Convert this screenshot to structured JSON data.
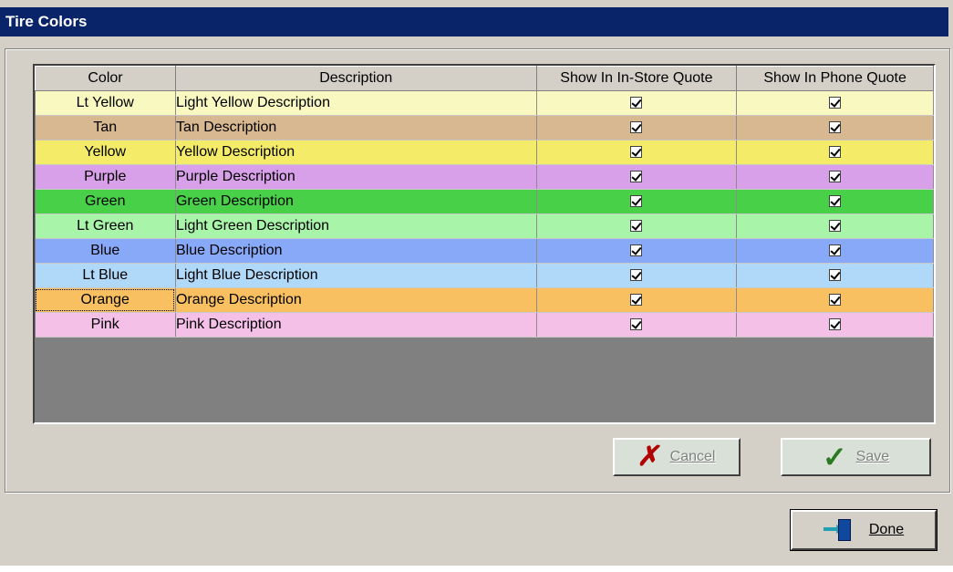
{
  "window": {
    "title": "Tire Colors"
  },
  "grid": {
    "columns": [
      "Color",
      "Description",
      "Show In In-Store Quote",
      "Show In Phone Quote"
    ],
    "rows": [
      {
        "color": "Lt Yellow",
        "description": "Light Yellow Description",
        "in_store": true,
        "phone": true,
        "bg": "#f8f8c0"
      },
      {
        "color": "Tan",
        "description": "Tan Description",
        "in_store": true,
        "phone": true,
        "bg": "#d8b890"
      },
      {
        "color": "Yellow",
        "description": "Yellow Description",
        "in_store": true,
        "phone": true,
        "bg": "#f4ec68"
      },
      {
        "color": "Purple",
        "description": "Purple Description",
        "in_store": true,
        "phone": true,
        "bg": "#d8a0e8"
      },
      {
        "color": "Green",
        "description": "Green Description",
        "in_store": true,
        "phone": true,
        "bg": "#48d048"
      },
      {
        "color": "Lt Green",
        "description": "Light Green Description",
        "in_store": true,
        "phone": true,
        "bg": "#a8f4a8"
      },
      {
        "color": "Blue",
        "description": "Blue Description",
        "in_store": true,
        "phone": true,
        "bg": "#88a8f8"
      },
      {
        "color": "Lt Blue",
        "description": "Light Blue Description",
        "in_store": true,
        "phone": true,
        "bg": "#b0d8f8"
      },
      {
        "color": "Orange",
        "description": "Orange Description",
        "in_store": true,
        "phone": true,
        "bg": "#f8c060",
        "focused": true
      },
      {
        "color": "Pink",
        "description": "Pink Description",
        "in_store": true,
        "phone": true,
        "bg": "#f4c0e8"
      }
    ]
  },
  "buttons": {
    "cancel": {
      "label": "Cancel",
      "icon": "x-icon",
      "enabled": false
    },
    "save": {
      "label": "Save",
      "icon": "checkmark-icon",
      "enabled": false
    },
    "done": {
      "label": "Done",
      "icon": "exit-door-icon",
      "enabled": true
    }
  }
}
